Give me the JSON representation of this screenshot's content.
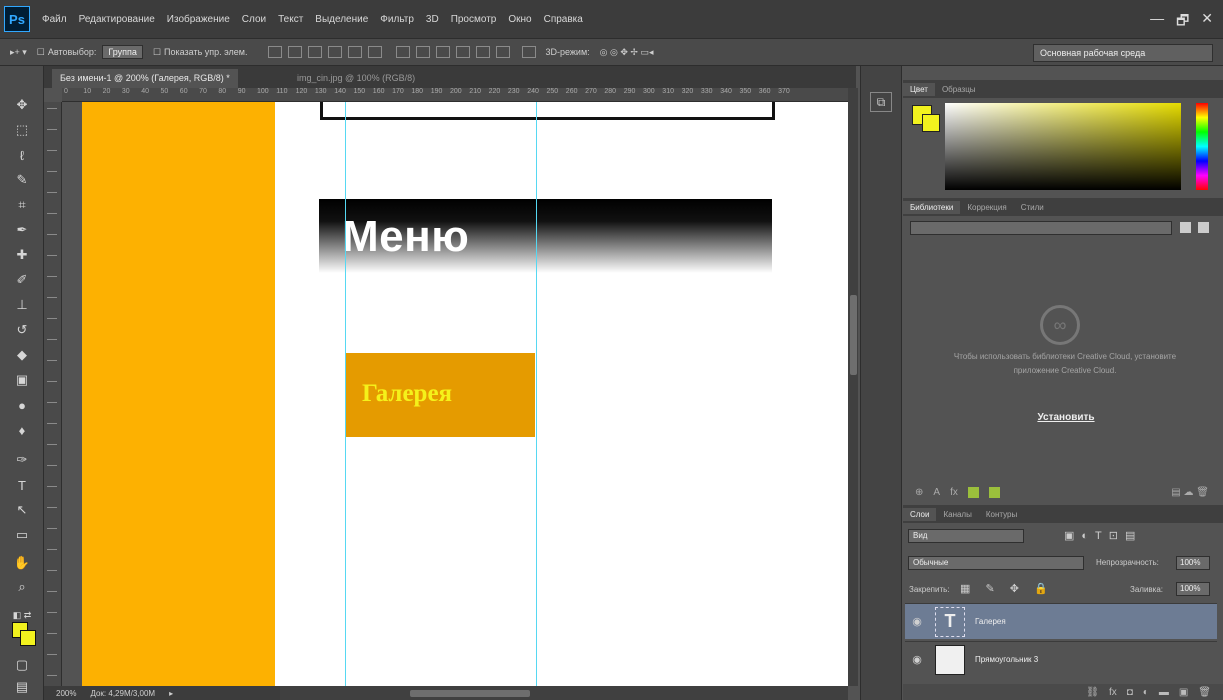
{
  "app": {
    "logo": "Ps",
    "menu": [
      "Файл",
      "Редактирование",
      "Изображение",
      "Слои",
      "Текст",
      "Выделение",
      "Фильтр",
      "3D",
      "Просмотр",
      "Окно",
      "Справка"
    ],
    "window_controls": [
      "—",
      "🗗",
      "✕"
    ]
  },
  "options": {
    "autoselect_label": "Автовыбор:",
    "autoselect_value": "Группа",
    "show_controls_label": "Показать упр. элем.",
    "mode_3d_label": "3D-режим:",
    "workspace": "Основная рабочая среда"
  },
  "tabs": [
    {
      "label": "Без имени-1 @ 200% (Галерея, RGB/8) *"
    },
    {
      "label": "img_cin.jpg @ 100% (RGB/8)"
    }
  ],
  "ruler": [
    "0",
    "10",
    "20",
    "30",
    "40",
    "50",
    "60",
    "70",
    "80",
    "90",
    "100",
    "110",
    "120",
    "130",
    "140",
    "150",
    "160",
    "170",
    "180",
    "190",
    "200",
    "210",
    "220",
    "230",
    "240",
    "250",
    "260",
    "270",
    "280",
    "290",
    "300",
    "310",
    "320",
    "330",
    "340",
    "350",
    "360",
    "370"
  ],
  "canvas": {
    "heading": "Меню",
    "button_text": "Галерея",
    "colors": {
      "orange_column": "#fdb101",
      "gallery_box": "#e59b00",
      "gallery_text": "#f5f11a",
      "guides": "#56d8f2"
    }
  },
  "status": {
    "zoom": "200%",
    "doc": "Док: 4,29М/3,00М"
  },
  "panels": {
    "color_tabs": [
      "Цвет",
      "Образцы"
    ],
    "library_tabs": [
      "Библиотеки",
      "Коррекция",
      "Стили"
    ],
    "library_message": "Чтобы использовать библиотеки Creative Cloud, установите приложение Creative Cloud.",
    "install_label": "Установить",
    "layers_tabs": [
      "Слои",
      "Каналы",
      "Контуры"
    ],
    "kind_filter": "Вид",
    "blend_mode": "Обычные",
    "opacity_label": "Непрозрачность:",
    "opacity_value": "100%",
    "lock_label": "Закрепить:",
    "fill_label": "Заливка:",
    "fill_value": "100%",
    "layers": [
      {
        "name": "Галерея",
        "thumb": "T",
        "selected": true
      },
      {
        "name": "Прямоугольник 3",
        "thumb": "",
        "selected": false
      }
    ]
  },
  "icons": {
    "tools": [
      "move-icon",
      "marquee-icon",
      "lasso-icon",
      "quick-select-icon",
      "crop-icon",
      "eyedropper-icon",
      "healing-icon",
      "brush-icon",
      "stamp-icon",
      "history-brush-icon",
      "eraser-icon",
      "gradient-icon",
      "blur-icon",
      "dodge-icon",
      "pen-icon",
      "type-icon",
      "path-select-icon",
      "rectangle-icon",
      "hand-icon",
      "zoom-icon"
    ]
  }
}
